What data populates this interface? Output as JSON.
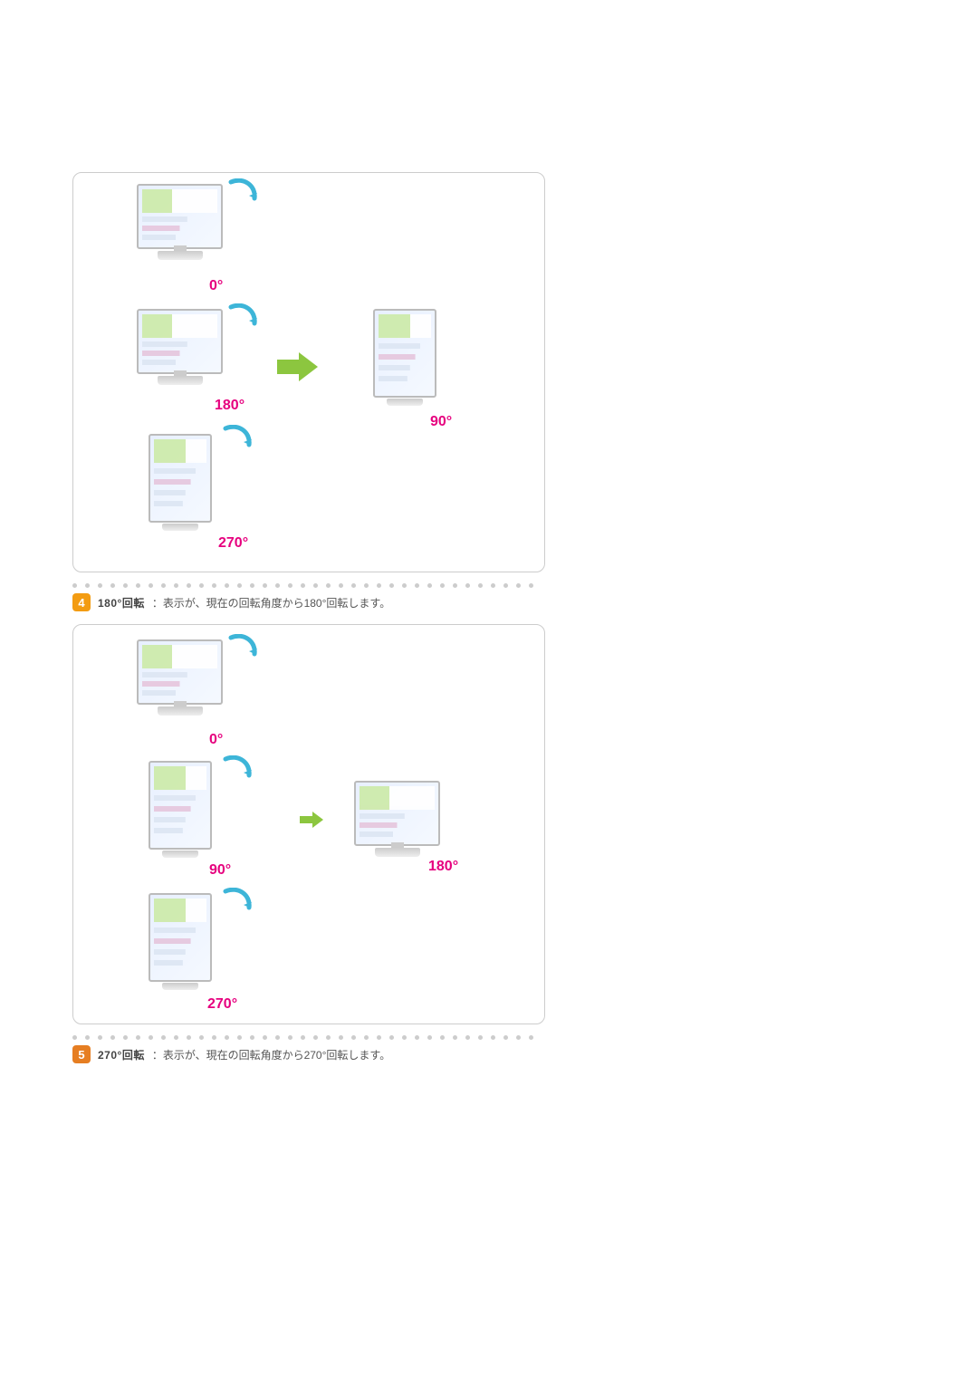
{
  "bullet4": {
    "number": "4",
    "bold": "180°回転",
    "rest": "：表示が、現在の回転角度から180°回転します。"
  },
  "bullet5": {
    "number": "5",
    "bold": "270°回転",
    "rest": "：表示が、現在の回転角度から270°回転します。"
  },
  "diagA": {
    "top": "0°",
    "mid": "180°",
    "bot": "270°",
    "right": "90°"
  },
  "diagB": {
    "top": "0°",
    "mid": "90°",
    "bot": "270°",
    "right": "180°"
  }
}
